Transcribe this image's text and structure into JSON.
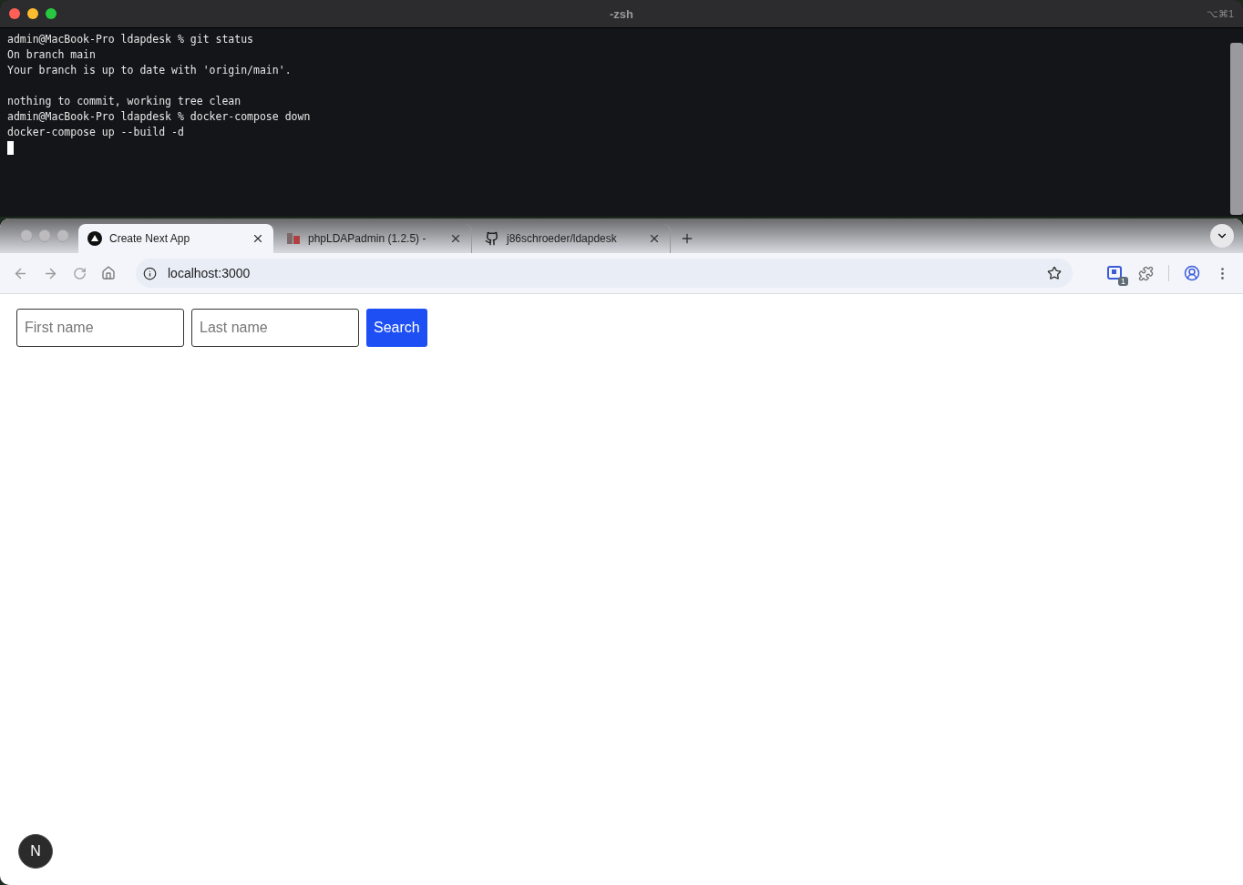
{
  "terminal": {
    "title": "-zsh",
    "shortcut": "⌥⌘1",
    "blocks": [
      [
        "admin@MacBook-Pro ldapdesk % git status",
        "On branch main",
        "Your branch is up to date with 'origin/main'."
      ],
      [
        "nothing to commit, working tree clean",
        "admin@MacBook-Pro ldapdesk % docker-compose down",
        "docker-compose up --build -d"
      ]
    ]
  },
  "browser": {
    "tabs": [
      {
        "title": "Create Next App",
        "selected": true
      },
      {
        "title": "phpLDAPadmin (1.2.5) -",
        "selected": false
      },
      {
        "title": "j86schroeder/ldapdesk",
        "selected": false
      }
    ],
    "address": "localhost:3000",
    "extension_badge": "1"
  },
  "page": {
    "fields": [
      {
        "placeholder": "First name"
      },
      {
        "placeholder": "Last name"
      }
    ],
    "search_button": "Search",
    "dev_badge": "N"
  }
}
